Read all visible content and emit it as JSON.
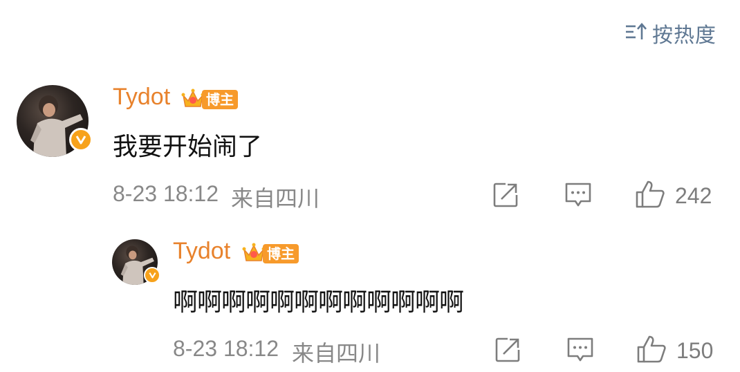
{
  "sort": {
    "label": "按热度",
    "icon": "sort-icon"
  },
  "comments": [
    {
      "username": "Tydot",
      "badge_label": "博主",
      "text": "我要开始闹了",
      "timestamp": "8-23 18:12",
      "location": "来自四川",
      "likes": "242",
      "icons": [
        "repost-icon",
        "comment-icon",
        "like-icon"
      ]
    },
    {
      "username": "Tydot",
      "badge_label": "博主",
      "text": "啊啊啊啊啊啊啊啊啊啊啊啊",
      "timestamp": "8-23 18:12",
      "location": "来自四川",
      "likes": "150",
      "icons": [
        "repost-icon",
        "comment-icon",
        "like-icon"
      ]
    }
  ],
  "colors": {
    "username": "#e8822c",
    "badge": "#f79a2b",
    "verified": "#f7a21b",
    "meta": "#888888",
    "sort": "#5f7893"
  }
}
